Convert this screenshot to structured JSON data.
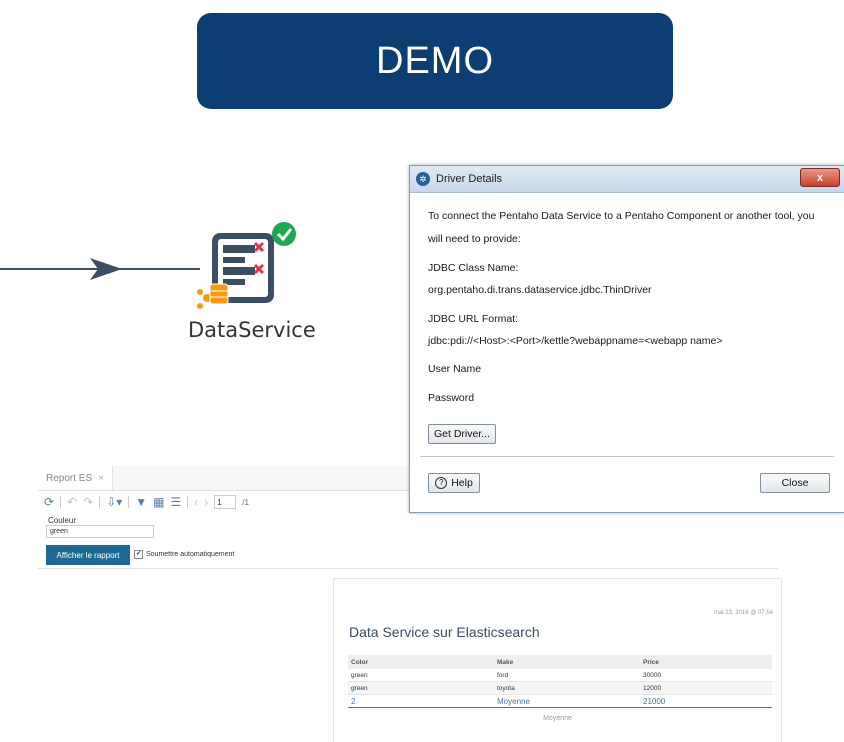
{
  "banner": {
    "text": "DEMO"
  },
  "step": {
    "label": "DataService"
  },
  "dialog": {
    "title": "Driver Details",
    "intro_line1": "To connect the Pentaho Data Service to a Pentaho Component or another tool, you",
    "intro_line2": "will need to provide:",
    "class_name_label": "JDBC Class Name:",
    "class_name_value": "org.pentaho.di.trans.dataservice.jdbc.ThinDriver",
    "url_format_label": "JDBC URL Format:",
    "url_format_value": "jdbc:pdi://<Host>:<Port>/kettle?webappname=<webapp name>",
    "user_name_label": "User Name",
    "password_label": "Password",
    "get_driver_label": "Get Driver...",
    "help_label": "Help",
    "close_label": "Close",
    "close_x": "x"
  },
  "report": {
    "tab_label": "Report ES",
    "tab_close": "×",
    "page_current": "1",
    "page_total": "/1",
    "param_label": "Couleur",
    "param_value": "green",
    "submit_label": "Afficher le rapport",
    "auto_submit_label": "Soumettre automatiquement",
    "auto_submit_checked": true
  },
  "report_page": {
    "date": "mai 23, 2016 @ 07:54",
    "title": "Data Service sur Elasticsearch",
    "columns": [
      "Color",
      "Make",
      "Price"
    ],
    "rows": [
      [
        "green",
        "ford",
        "30000"
      ],
      [
        "green",
        "toyota",
        "12000"
      ]
    ],
    "summary": [
      "2",
      "Moyenne",
      "21000"
    ],
    "footer": "Moyenne"
  },
  "colors": {
    "banner_bg": "#0d3e73",
    "submit_bg": "#1e6a93",
    "step_icon": "#3c4e63",
    "status_ok": "#1fa651",
    "error_x": "#e0344a",
    "db_orange": "#f39c12"
  }
}
